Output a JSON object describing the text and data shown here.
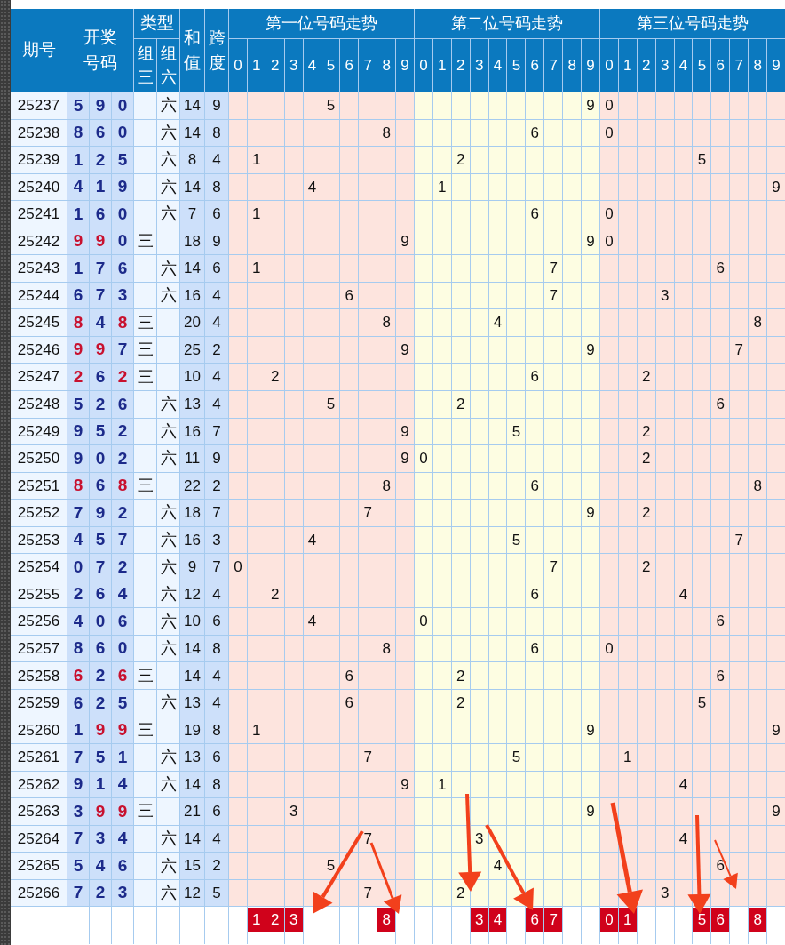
{
  "header": {
    "period": "期号",
    "number": "开奖号码",
    "type": "类型",
    "type_three": "组三",
    "type_six": "组六",
    "sum": "和值",
    "span": "跨度"
  },
  "trend_groups": [
    {
      "title": "第一位号码走势",
      "digits": [
        "0",
        "1",
        "2",
        "3",
        "4",
        "5",
        "6",
        "7",
        "8",
        "9"
      ]
    },
    {
      "title": "第二位号码走势",
      "digits": [
        "0",
        "1",
        "2",
        "3",
        "4",
        "5",
        "6",
        "7",
        "8",
        "9"
      ]
    },
    {
      "title": "第三位号码走势",
      "digits": [
        "0",
        "1",
        "2",
        "3",
        "4",
        "5",
        "6",
        "7",
        "8",
        "9"
      ]
    }
  ],
  "rows": [
    {
      "period": "25237",
      "digits": [
        {
          "d": "5",
          "repeat": false
        },
        {
          "d": "9",
          "repeat": false
        },
        {
          "d": "0",
          "repeat": false
        }
      ],
      "kind": "six",
      "type_label": "六",
      "sum": "14",
      "span": "9",
      "trend": [
        "5",
        "9",
        "0"
      ]
    },
    {
      "period": "25238",
      "digits": [
        {
          "d": "8",
          "repeat": false
        },
        {
          "d": "6",
          "repeat": false
        },
        {
          "d": "0",
          "repeat": false
        }
      ],
      "kind": "six",
      "type_label": "六",
      "sum": "14",
      "span": "8",
      "trend": [
        "8",
        "6",
        "0"
      ]
    },
    {
      "period": "25239",
      "digits": [
        {
          "d": "1",
          "repeat": false
        },
        {
          "d": "2",
          "repeat": false
        },
        {
          "d": "5",
          "repeat": false
        }
      ],
      "kind": "six",
      "type_label": "六",
      "sum": "8",
      "span": "4",
      "trend": [
        "1",
        "2",
        "5"
      ]
    },
    {
      "period": "25240",
      "digits": [
        {
          "d": "4",
          "repeat": false
        },
        {
          "d": "1",
          "repeat": false
        },
        {
          "d": "9",
          "repeat": false
        }
      ],
      "kind": "six",
      "type_label": "六",
      "sum": "14",
      "span": "8",
      "trend": [
        "4",
        "1",
        "9"
      ]
    },
    {
      "period": "25241",
      "digits": [
        {
          "d": "1",
          "repeat": false
        },
        {
          "d": "6",
          "repeat": false
        },
        {
          "d": "0",
          "repeat": false
        }
      ],
      "kind": "six",
      "type_label": "六",
      "sum": "7",
      "span": "6",
      "trend": [
        "1",
        "6",
        "0"
      ]
    },
    {
      "period": "25242",
      "digits": [
        {
          "d": "9",
          "repeat": true
        },
        {
          "d": "9",
          "repeat": true
        },
        {
          "d": "0",
          "repeat": false
        }
      ],
      "kind": "three",
      "type_label": "三",
      "sum": "18",
      "span": "9",
      "trend": [
        "9",
        "9",
        "0"
      ]
    },
    {
      "period": "25243",
      "digits": [
        {
          "d": "1",
          "repeat": false
        },
        {
          "d": "7",
          "repeat": false
        },
        {
          "d": "6",
          "repeat": false
        }
      ],
      "kind": "six",
      "type_label": "六",
      "sum": "14",
      "span": "6",
      "trend": [
        "1",
        "7",
        "6"
      ]
    },
    {
      "period": "25244",
      "digits": [
        {
          "d": "6",
          "repeat": false
        },
        {
          "d": "7",
          "repeat": false
        },
        {
          "d": "3",
          "repeat": false
        }
      ],
      "kind": "six",
      "type_label": "六",
      "sum": "16",
      "span": "4",
      "trend": [
        "6",
        "7",
        "3"
      ]
    },
    {
      "period": "25245",
      "digits": [
        {
          "d": "8",
          "repeat": true
        },
        {
          "d": "4",
          "repeat": false
        },
        {
          "d": "8",
          "repeat": true
        }
      ],
      "kind": "three",
      "type_label": "三",
      "sum": "20",
      "span": "4",
      "trend": [
        "8",
        "4",
        "8"
      ]
    },
    {
      "period": "25246",
      "digits": [
        {
          "d": "9",
          "repeat": true
        },
        {
          "d": "9",
          "repeat": true
        },
        {
          "d": "7",
          "repeat": false
        }
      ],
      "kind": "three",
      "type_label": "三",
      "sum": "25",
      "span": "2",
      "trend": [
        "9",
        "9",
        "7"
      ]
    },
    {
      "period": "25247",
      "digits": [
        {
          "d": "2",
          "repeat": true
        },
        {
          "d": "6",
          "repeat": false
        },
        {
          "d": "2",
          "repeat": true
        }
      ],
      "kind": "three",
      "type_label": "三",
      "sum": "10",
      "span": "4",
      "trend": [
        "2",
        "6",
        "2"
      ]
    },
    {
      "period": "25248",
      "digits": [
        {
          "d": "5",
          "repeat": false
        },
        {
          "d": "2",
          "repeat": false
        },
        {
          "d": "6",
          "repeat": false
        }
      ],
      "kind": "six",
      "type_label": "六",
      "sum": "13",
      "span": "4",
      "trend": [
        "5",
        "2",
        "6"
      ]
    },
    {
      "period": "25249",
      "digits": [
        {
          "d": "9",
          "repeat": false
        },
        {
          "d": "5",
          "repeat": false
        },
        {
          "d": "2",
          "repeat": false
        }
      ],
      "kind": "six",
      "type_label": "六",
      "sum": "16",
      "span": "7",
      "trend": [
        "9",
        "5",
        "2"
      ]
    },
    {
      "period": "25250",
      "digits": [
        {
          "d": "9",
          "repeat": false
        },
        {
          "d": "0",
          "repeat": false
        },
        {
          "d": "2",
          "repeat": false
        }
      ],
      "kind": "six",
      "type_label": "六",
      "sum": "11",
      "span": "9",
      "trend": [
        "9",
        "0",
        "2"
      ]
    },
    {
      "period": "25251",
      "digits": [
        {
          "d": "8",
          "repeat": true
        },
        {
          "d": "6",
          "repeat": false
        },
        {
          "d": "8",
          "repeat": true
        }
      ],
      "kind": "three",
      "type_label": "三",
      "sum": "22",
      "span": "2",
      "trend": [
        "8",
        "6",
        "8"
      ]
    },
    {
      "period": "25252",
      "digits": [
        {
          "d": "7",
          "repeat": false
        },
        {
          "d": "9",
          "repeat": false
        },
        {
          "d": "2",
          "repeat": false
        }
      ],
      "kind": "six",
      "type_label": "六",
      "sum": "18",
      "span": "7",
      "trend": [
        "7",
        "9",
        "2"
      ]
    },
    {
      "period": "25253",
      "digits": [
        {
          "d": "4",
          "repeat": false
        },
        {
          "d": "5",
          "repeat": false
        },
        {
          "d": "7",
          "repeat": false
        }
      ],
      "kind": "six",
      "type_label": "六",
      "sum": "16",
      "span": "3",
      "trend": [
        "4",
        "5",
        "7"
      ]
    },
    {
      "period": "25254",
      "digits": [
        {
          "d": "0",
          "repeat": false
        },
        {
          "d": "7",
          "repeat": false
        },
        {
          "d": "2",
          "repeat": false
        }
      ],
      "kind": "six",
      "type_label": "六",
      "sum": "9",
      "span": "7",
      "trend": [
        "0",
        "7",
        "2"
      ]
    },
    {
      "period": "25255",
      "digits": [
        {
          "d": "2",
          "repeat": false
        },
        {
          "d": "6",
          "repeat": false
        },
        {
          "d": "4",
          "repeat": false
        }
      ],
      "kind": "six",
      "type_label": "六",
      "sum": "12",
      "span": "4",
      "trend": [
        "2",
        "6",
        "4"
      ]
    },
    {
      "period": "25256",
      "digits": [
        {
          "d": "4",
          "repeat": false
        },
        {
          "d": "0",
          "repeat": false
        },
        {
          "d": "6",
          "repeat": false
        }
      ],
      "kind": "six",
      "type_label": "六",
      "sum": "10",
      "span": "6",
      "trend": [
        "4",
        "0",
        "6"
      ]
    },
    {
      "period": "25257",
      "digits": [
        {
          "d": "8",
          "repeat": false
        },
        {
          "d": "6",
          "repeat": false
        },
        {
          "d": "0",
          "repeat": false
        }
      ],
      "kind": "six",
      "type_label": "六",
      "sum": "14",
      "span": "8",
      "trend": [
        "8",
        "6",
        "0"
      ]
    },
    {
      "period": "25258",
      "digits": [
        {
          "d": "6",
          "repeat": true
        },
        {
          "d": "2",
          "repeat": false
        },
        {
          "d": "6",
          "repeat": true
        }
      ],
      "kind": "three",
      "type_label": "三",
      "sum": "14",
      "span": "4",
      "trend": [
        "6",
        "2",
        "6"
      ]
    },
    {
      "period": "25259",
      "digits": [
        {
          "d": "6",
          "repeat": false
        },
        {
          "d": "2",
          "repeat": false
        },
        {
          "d": "5",
          "repeat": false
        }
      ],
      "kind": "six",
      "type_label": "六",
      "sum": "13",
      "span": "4",
      "trend": [
        "6",
        "2",
        "5"
      ]
    },
    {
      "period": "25260",
      "digits": [
        {
          "d": "1",
          "repeat": false
        },
        {
          "d": "9",
          "repeat": true
        },
        {
          "d": "9",
          "repeat": true
        }
      ],
      "kind": "three",
      "type_label": "三",
      "sum": "19",
      "span": "8",
      "trend": [
        "1",
        "9",
        "9"
      ]
    },
    {
      "period": "25261",
      "digits": [
        {
          "d": "7",
          "repeat": false
        },
        {
          "d": "5",
          "repeat": false
        },
        {
          "d": "1",
          "repeat": false
        }
      ],
      "kind": "six",
      "type_label": "六",
      "sum": "13",
      "span": "6",
      "trend": [
        "7",
        "5",
        "1"
      ]
    },
    {
      "period": "25262",
      "digits": [
        {
          "d": "9",
          "repeat": false
        },
        {
          "d": "1",
          "repeat": false
        },
        {
          "d": "4",
          "repeat": false
        }
      ],
      "kind": "six",
      "type_label": "六",
      "sum": "14",
      "span": "8",
      "trend": [
        "9",
        "1",
        "4"
      ]
    },
    {
      "period": "25263",
      "digits": [
        {
          "d": "3",
          "repeat": false
        },
        {
          "d": "9",
          "repeat": true
        },
        {
          "d": "9",
          "repeat": true
        }
      ],
      "kind": "three",
      "type_label": "三",
      "sum": "21",
      "span": "6",
      "trend": [
        "3",
        "9",
        "9"
      ]
    },
    {
      "period": "25264",
      "digits": [
        {
          "d": "7",
          "repeat": false
        },
        {
          "d": "3",
          "repeat": false
        },
        {
          "d": "4",
          "repeat": false
        }
      ],
      "kind": "six",
      "type_label": "六",
      "sum": "14",
      "span": "4",
      "trend": [
        "7",
        "3",
        "4"
      ]
    },
    {
      "period": "25265",
      "digits": [
        {
          "d": "5",
          "repeat": false
        },
        {
          "d": "4",
          "repeat": false
        },
        {
          "d": "6",
          "repeat": false
        }
      ],
      "kind": "six",
      "type_label": "六",
      "sum": "15",
      "span": "2",
      "trend": [
        "5",
        "4",
        "6"
      ]
    },
    {
      "period": "25266",
      "digits": [
        {
          "d": "7",
          "repeat": false
        },
        {
          "d": "2",
          "repeat": false
        },
        {
          "d": "3",
          "repeat": false
        }
      ],
      "kind": "six",
      "type_label": "六",
      "sum": "12",
      "span": "5",
      "trend": [
        "7",
        "2",
        "3"
      ]
    }
  ],
  "picks": [
    [
      "1",
      "2",
      "3",
      "8"
    ],
    [
      "3",
      "4",
      "6",
      "7"
    ],
    [
      "0",
      "1",
      "5",
      "6",
      "8"
    ]
  ]
}
